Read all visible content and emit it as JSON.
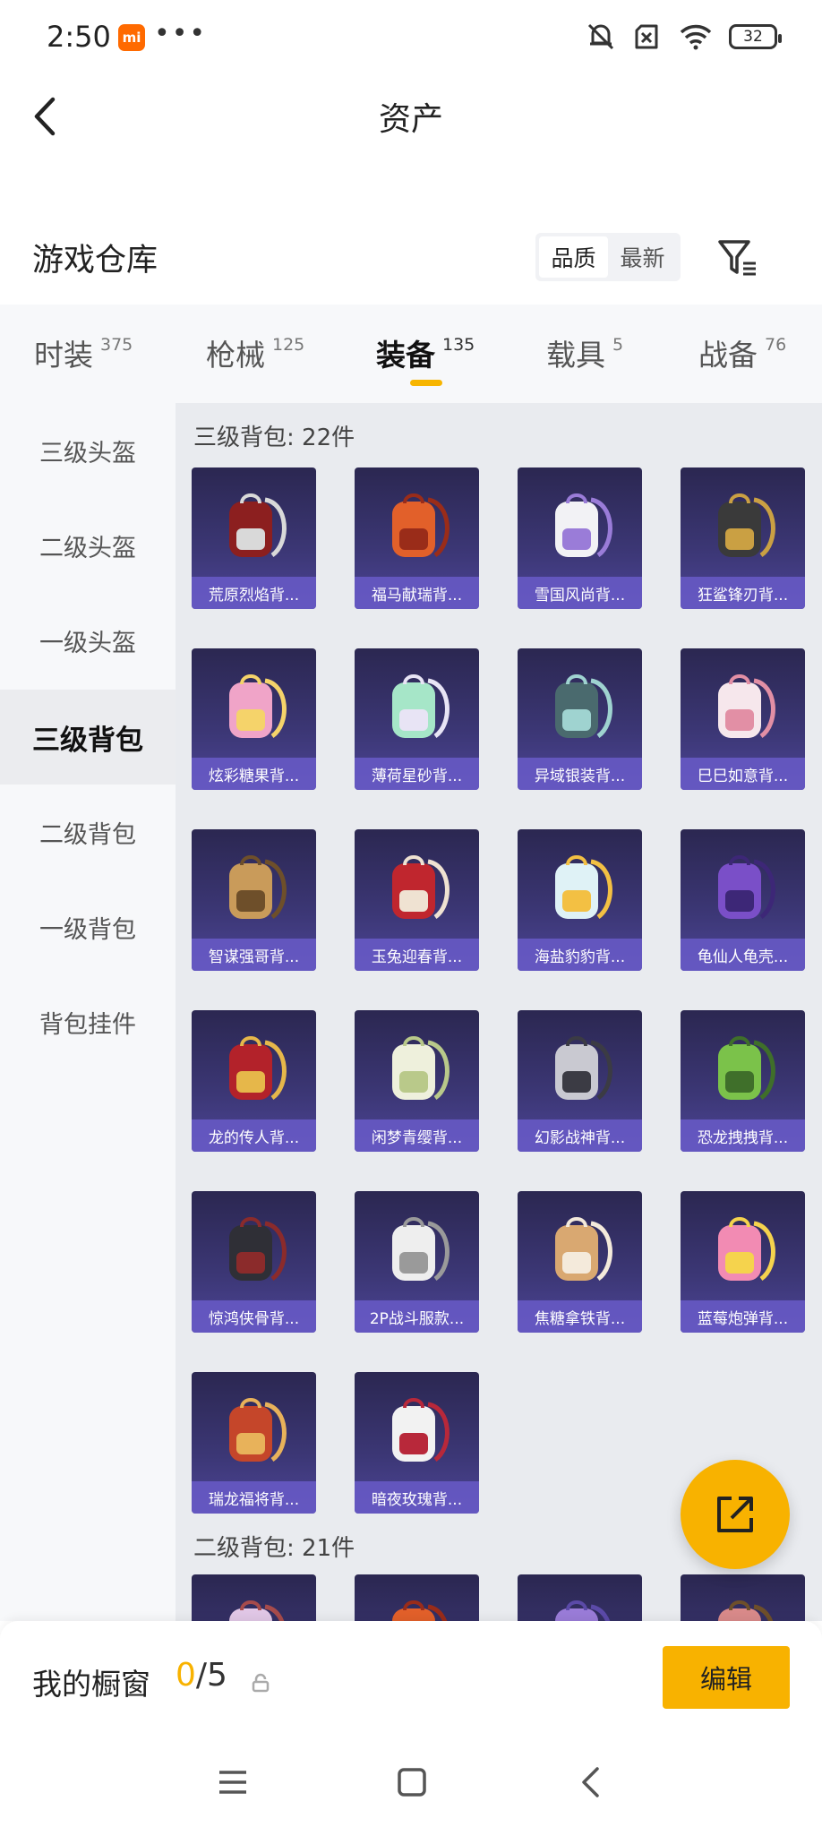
{
  "status_bar": {
    "time": "2:50",
    "mi_label": "mi",
    "dots": "•••",
    "battery": "32"
  },
  "header": {
    "title": "资产"
  },
  "warehouse": {
    "title": "游戏仓库",
    "sort_options": [
      "品质",
      "最新"
    ]
  },
  "categories": [
    {
      "label": "时装",
      "count": "375"
    },
    {
      "label": "枪械",
      "count": "125"
    },
    {
      "label": "装备",
      "count": "135"
    },
    {
      "label": "载具",
      "count": "5"
    },
    {
      "label": "战备",
      "count": "76"
    }
  ],
  "sidebar": {
    "items": [
      "三级头盔",
      "二级头盔",
      "一级头盔",
      "三级背包",
      "二级背包",
      "一级背包",
      "背包挂件"
    ]
  },
  "sections": [
    {
      "title": "三级背包: 22件",
      "items": [
        {
          "name": "荒原烈焰背...",
          "colors": [
            "#8c1f1f",
            "#d9d9d9"
          ]
        },
        {
          "name": "福马献瑞背...",
          "colors": [
            "#e2602a",
            "#9a2c19"
          ]
        },
        {
          "name": "雪国风尚背...",
          "colors": [
            "#f2f2f5",
            "#9a7cd8"
          ]
        },
        {
          "name": "狂鲨锋刃背...",
          "colors": [
            "#3a3a3a",
            "#caa043"
          ]
        },
        {
          "name": "炫彩糖果背...",
          "colors": [
            "#f0a4c8",
            "#f5d36a"
          ]
        },
        {
          "name": "薄荷星砂背...",
          "colors": [
            "#a6e6c8",
            "#e8e4f5"
          ]
        },
        {
          "name": "异域银装背...",
          "colors": [
            "#4a6a6e",
            "#9fd3d0"
          ]
        },
        {
          "name": "巳巳如意背...",
          "colors": [
            "#f6e7ec",
            "#e28fa5"
          ]
        },
        {
          "name": "智谋强哥背...",
          "colors": [
            "#c99b5a",
            "#6e4f2a"
          ]
        },
        {
          "name": "玉兔迎春背...",
          "colors": [
            "#c0262e",
            "#efe2d2"
          ]
        },
        {
          "name": "海盐豹豹背...",
          "colors": [
            "#dff2f6",
            "#f3c043"
          ]
        },
        {
          "name": "龟仙人龟壳...",
          "colors": [
            "#7a4fc8",
            "#3d2777"
          ]
        },
        {
          "name": "龙的传人背...",
          "colors": [
            "#b3222a",
            "#e6b74a"
          ]
        },
        {
          "name": "闲梦青缨背...",
          "colors": [
            "#eef0dc",
            "#b9c98a"
          ]
        },
        {
          "name": "幻影战神背...",
          "colors": [
            "#c9c9d1",
            "#3b3b44"
          ]
        },
        {
          "name": "恐龙拽拽背...",
          "colors": [
            "#7bc24a",
            "#3f6f2a"
          ]
        },
        {
          "name": "惊鸿侠骨背...",
          "colors": [
            "#2f2f36",
            "#8b2b2b"
          ]
        },
        {
          "name": "2P战斗服款...",
          "colors": [
            "#eeeeee",
            "#9a9a9a"
          ]
        },
        {
          "name": "焦糖拿铁背...",
          "colors": [
            "#d9a871",
            "#f4eadb"
          ]
        },
        {
          "name": "蓝莓炮弹背...",
          "colors": [
            "#f28bb3",
            "#f5d34d"
          ]
        },
        {
          "name": "瑞龙福将背...",
          "colors": [
            "#c5462a",
            "#e8b25a"
          ]
        },
        {
          "name": "暗夜玫瑰背...",
          "colors": [
            "#f2f2f2",
            "#b8283a"
          ]
        }
      ]
    },
    {
      "title": "二级背包: 21件",
      "items": [
        {
          "name": "",
          "colors": [
            "#e1c7e6",
            "#a74b4b"
          ]
        },
        {
          "name": "",
          "colors": [
            "#e2602a",
            "#9a2c19"
          ]
        },
        {
          "name": "",
          "colors": [
            "#9a7cd8",
            "#5b4aa8"
          ]
        },
        {
          "name": "",
          "colors": [
            "#d98a8a",
            "#6e4f2a"
          ]
        }
      ]
    }
  ],
  "bottom_bar": {
    "showcase_label": "我的橱窗",
    "count_current": "0",
    "count_sep": "/",
    "count_max": "5",
    "edit_label": "编辑"
  },
  "colors": {
    "accent": "#f8b200",
    "card_label_bg": "#685ac8"
  }
}
